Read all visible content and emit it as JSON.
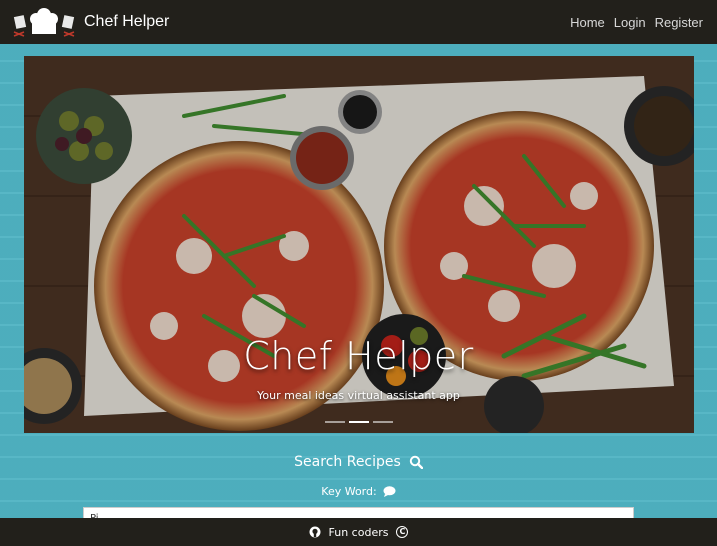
{
  "navbar": {
    "brand": "Chef Helper",
    "links": [
      "Home",
      "Login",
      "Register"
    ]
  },
  "hero": {
    "title": "Chef Helper",
    "subtitle": "Your meal ideas virtual assistant app"
  },
  "search": {
    "heading": "Search Recipes",
    "keyword_label": "Key Word:",
    "keyword_value": "Pi"
  },
  "footer": {
    "text": "Fun coders"
  },
  "colors": {
    "navbar": "#22201b",
    "background": "#4fb3c3",
    "text": "#ffffff"
  }
}
